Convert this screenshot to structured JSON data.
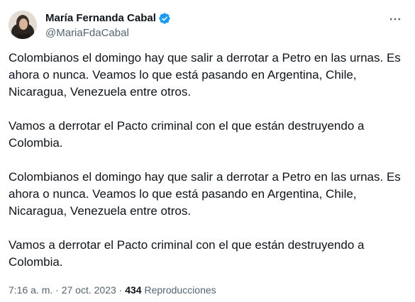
{
  "author": {
    "display_name": "María Fernanda Cabal",
    "handle": "@MariaFdaCabal",
    "verified": true
  },
  "tweet": {
    "paragraphs": [
      "Colombianos el domingo hay que salir a derrotar a Petro en las urnas. Es ahora o nunca. Veamos lo que está pasando en Argentina, Chile, Nicaragua, Venezuela entre otros.",
      "Vamos a derrotar el Pacto criminal con el que están destruyendo a Colombia.",
      "Colombianos el domingo hay que salir a derrotar a Petro en las urnas. Es ahora o nunca. Veamos lo que está pasando en Argentina, Chile, Nicaragua, Venezuela entre otros.",
      "Vamos a derrotar el Pacto criminal con el que están destruyendo a Colombia."
    ],
    "time": "7:16 a. m.",
    "separator": "·",
    "date": "27 oct. 2023",
    "views_count": "434",
    "views_label": "Reproducciones"
  },
  "colors": {
    "verified_badge": "#1d9bf0",
    "secondary_text": "#536471",
    "primary_text": "#0f1419"
  },
  "icons": {
    "verified": "verified-badge-icon",
    "more": "more-options-icon"
  }
}
